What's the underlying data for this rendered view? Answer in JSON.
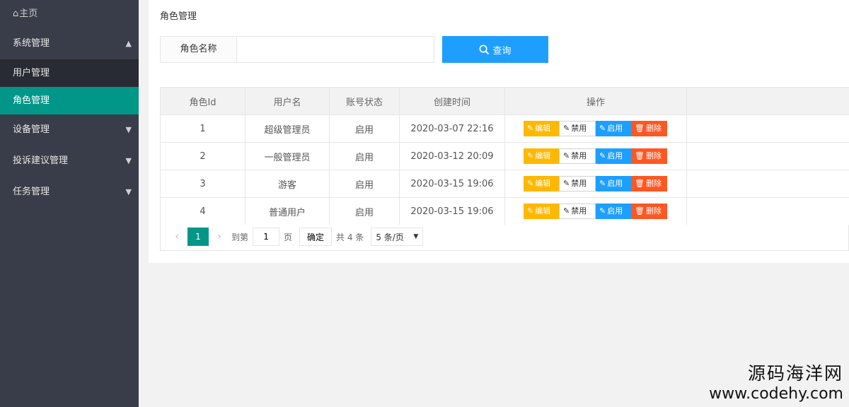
{
  "sidebar": {
    "home_icon": "⌂",
    "home_label": "主页",
    "groups": [
      {
        "label": "系统管理",
        "arrow": "▲",
        "expanded": true
      },
      {
        "label": "设备管理",
        "arrow": "▼"
      },
      {
        "label": "投诉建议管理",
        "arrow": "▼"
      },
      {
        "label": "任务管理",
        "arrow": "▼"
      }
    ],
    "sub_items": [
      {
        "label": "用户管理",
        "active": false
      },
      {
        "label": "角色管理",
        "active": true
      }
    ]
  },
  "main": {
    "title": "角色管理",
    "search": {
      "label": "角色名称",
      "value": "",
      "button": "查询",
      "button_icon": "search-icon"
    },
    "table": {
      "headers": [
        "角色Id",
        "用户名",
        "账号状态",
        "创建时间",
        "操作"
      ],
      "rows": [
        {
          "id": "1",
          "name": "超级管理员",
          "status": "启用",
          "created": "2020-03-07 22:16"
        },
        {
          "id": "2",
          "name": "一般管理员",
          "status": "启用",
          "created": "2020-03-12 20:09"
        },
        {
          "id": "3",
          "name": "游客",
          "status": "启用",
          "created": "2020-03-15 19:06"
        },
        {
          "id": "4",
          "name": "普通用户",
          "status": "启用",
          "created": "2020-03-15 19:06"
        }
      ],
      "actions": {
        "edit": "编辑",
        "disable": "禁用",
        "enable": "启用",
        "delete": "删除"
      }
    },
    "pager": {
      "prev": "‹",
      "next": "›",
      "current_page": "1",
      "goto_label": "到第",
      "goto_value": "1",
      "page_suffix": "页",
      "confirm": "确定",
      "total": "共 4 条",
      "page_size": "5 条/页",
      "select_arrow": "▼"
    }
  },
  "watermark": {
    "cn": "源码海洋网",
    "url": "www.codehy.com"
  },
  "colors": {
    "sidebar": "#393d49",
    "active": "#009688",
    "primary": "#1e9fff",
    "warn": "#ffb800",
    "danger": "#ff5722"
  }
}
